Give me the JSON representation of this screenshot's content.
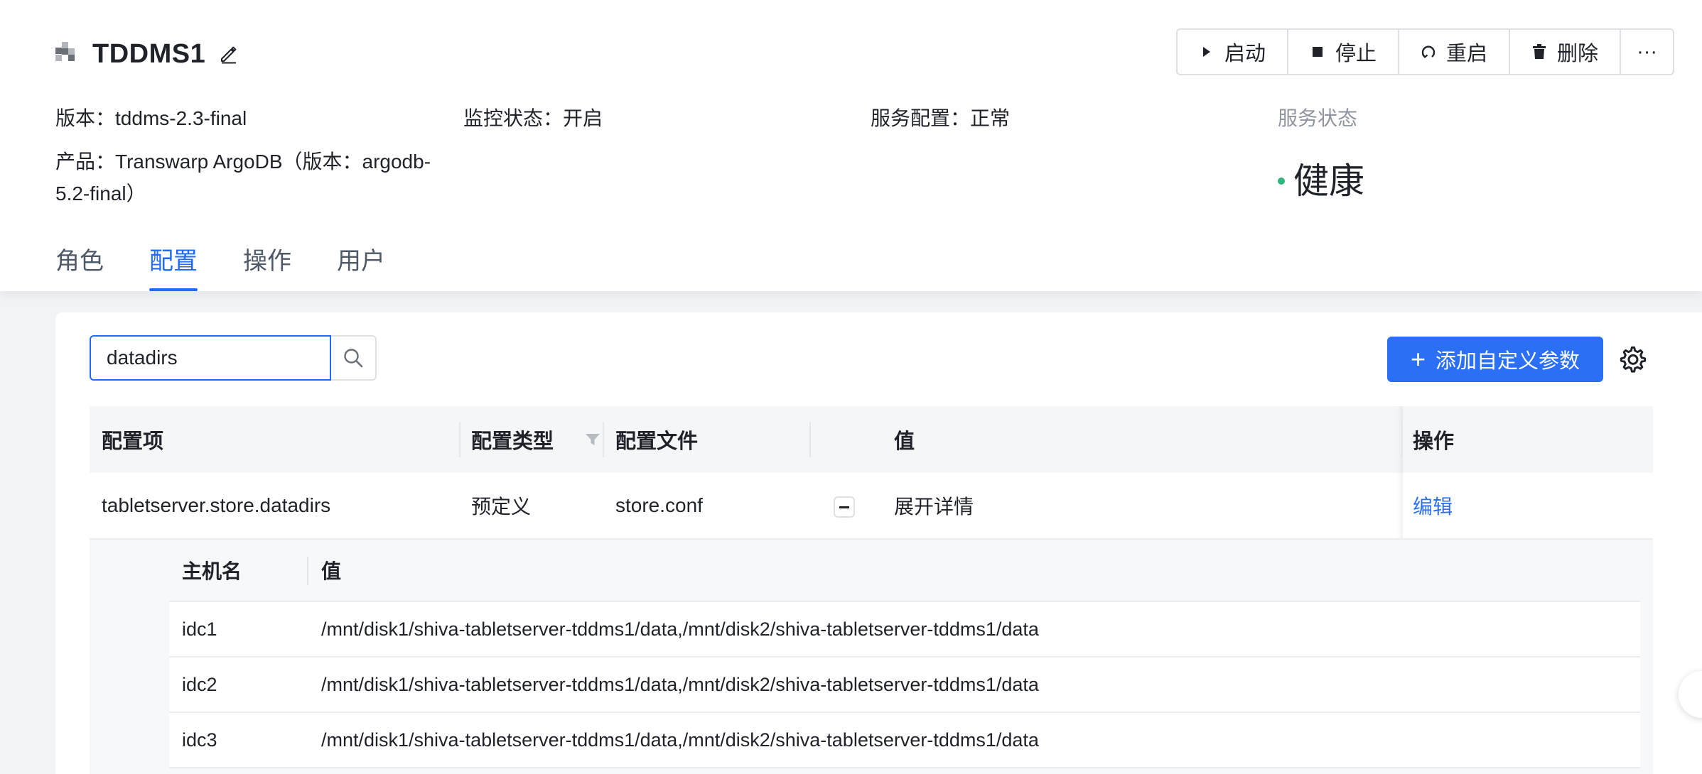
{
  "service": {
    "title": "TDDMS1",
    "version_label": "版本：",
    "version": "tddms-2.3-final",
    "monitor_label": "监控状态：",
    "monitor": "开启",
    "config_label": "服务配置：",
    "config": "正常",
    "product_label": "产品：",
    "product_line1": "Transwarp ArgoDB（版本：argodb-",
    "product_line2": "5.2-final）",
    "status_label": "服务状态",
    "status": "健康",
    "status_color": "#2fb67c"
  },
  "actions": {
    "start": "启动",
    "stop": "停止",
    "restart": "重启",
    "delete": "删除",
    "more": "···"
  },
  "tabs": [
    "角色",
    "配置",
    "操作",
    "用户"
  ],
  "active_tab": "配置",
  "search": {
    "value": "datadirs",
    "placeholder": ""
  },
  "add_button": "添加自定义参数",
  "table": {
    "headers": {
      "item": "配置项",
      "type": "配置类型",
      "file": "配置文件",
      "value": "值",
      "ops": "操作"
    },
    "rows": [
      {
        "item": "tabletserver.store.datadirs",
        "type": "预定义",
        "file": "store.conf",
        "value": "展开详情",
        "op": "编辑"
      }
    ]
  },
  "details": {
    "headers": {
      "host": "主机名",
      "value": "值"
    },
    "rows": [
      {
        "host": "idc1",
        "value": "/mnt/disk1/shiva-tabletserver-tddms1/data,/mnt/disk2/shiva-tabletserver-tddms1/data"
      },
      {
        "host": "idc2",
        "value": "/mnt/disk1/shiva-tabletserver-tddms1/data,/mnt/disk2/shiva-tabletserver-tddms1/data"
      },
      {
        "host": "idc3",
        "value": "/mnt/disk1/shiva-tabletserver-tddms1/data,/mnt/disk2/shiva-tabletserver-tddms1/data"
      }
    ]
  },
  "colors": {
    "primary": "#2a6ff6",
    "tab_active": "#1f6bff"
  }
}
